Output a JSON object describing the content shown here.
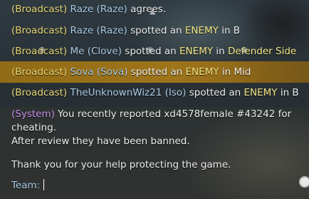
{
  "chat": {
    "lines": [
      {
        "tag": "(Broadcast)",
        "name": "Raze (Raze)",
        "text": " agrees."
      },
      {
        "tag": "(Broadcast)",
        "name": "Raze (Raze)",
        "text": " spotted an ",
        "keyword": "ENEMY",
        "text2": " in B"
      },
      {
        "tag": "(Broadcast)",
        "name": "Me (Clove)",
        "text": " spotted an ",
        "keyword": "ENEMY",
        "text2": " in ",
        "location": "Defender Side"
      },
      {
        "tag": "(Broadcast)",
        "name": "Sova (Sova)",
        "text": " spotted an ",
        "keyword": "ENEMY",
        "text2": " in Mid"
      },
      {
        "tag": "(Broadcast)",
        "name": "TheUnknownWiz21 (Iso)",
        "text": " spotted an ",
        "keyword": "ENEMY",
        "text2": " in B"
      }
    ],
    "system": {
      "tag": "(System)",
      "line1": " You recently reported xd4578female #43242 for",
      "line2": "cheating.",
      "line3": "After review they have been banned.",
      "line4": "Thank you for your help protecting the game."
    },
    "input": {
      "label": "Team:",
      "value": ""
    }
  },
  "colors": {
    "broadcast_tag": "#e8d775",
    "player_name": "#a9cbe5",
    "system_tag": "#c990e6",
    "highlight": "#a5781a"
  }
}
